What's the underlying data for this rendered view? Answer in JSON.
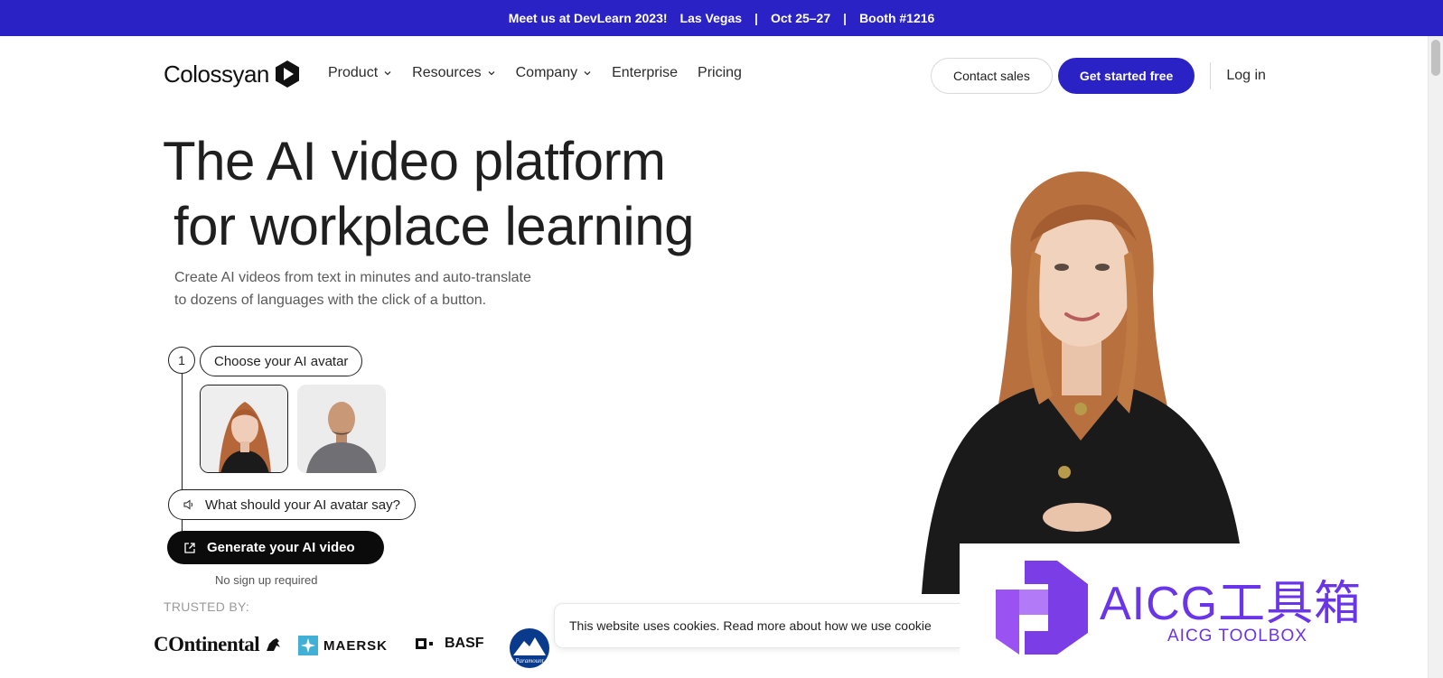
{
  "announcement": {
    "event": "Meet us at DevLearn 2023!",
    "location": "Las Vegas",
    "dates": "Oct 25–27",
    "booth": "Booth #1216",
    "separator": "|"
  },
  "nav": {
    "logo_text": "Colossyan",
    "items": [
      {
        "label": "Product",
        "dropdown": true
      },
      {
        "label": "Resources",
        "dropdown": true
      },
      {
        "label": "Company",
        "dropdown": true
      },
      {
        "label": "Enterprise",
        "dropdown": false
      },
      {
        "label": "Pricing",
        "dropdown": false
      }
    ],
    "contact_sales": "Contact sales",
    "get_started": "Get started free",
    "login": "Log in"
  },
  "hero": {
    "title_line1": "The AI video platform",
    "title_line2": "for workplace learning",
    "subtitle_line1": "Create AI videos from text in minutes and auto-translate",
    "subtitle_line2": "to dozens of languages with the click of a button."
  },
  "steps": {
    "step_number": "1",
    "choose_avatar": "Choose your AI avatar",
    "say_prompt": "What should your AI avatar say?",
    "generate_button": "Generate your AI video",
    "no_signup": "No sign up required"
  },
  "trusted": {
    "label": "TRUSTED BY:",
    "brands": [
      "Ontinental",
      "MAERSK",
      "BASF",
      "Paramount"
    ]
  },
  "cookie_banner": {
    "text": "This website uses cookies. Read more about how we use cookie"
  },
  "watermark": {
    "title": "AICG工具箱",
    "subtitle": "AICG TOOLBOX"
  },
  "colors": {
    "brand_blue": "#2a22c4",
    "watermark_purple": "#6a35e8"
  }
}
